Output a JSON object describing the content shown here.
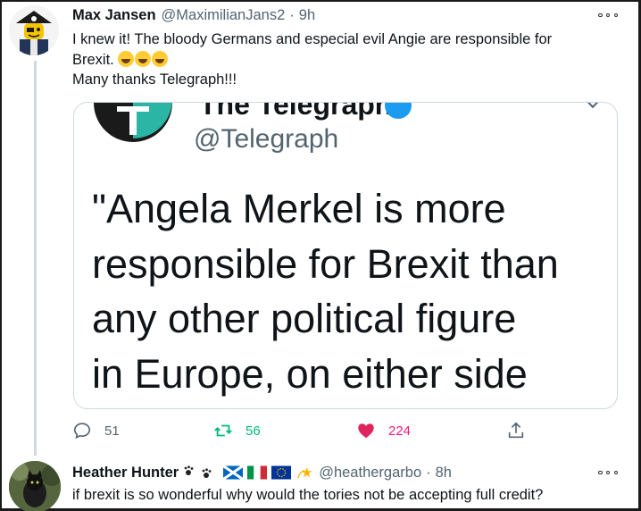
{
  "tweet": {
    "author_name": "Max Jansen",
    "author_handle": "@MaximilianJans2",
    "separator": "·",
    "time": "9h",
    "text_line1": "I knew it! The bloody Germans and especial evil Angie are responsible for",
    "text_line2_prefix": "Brexit.",
    "text_line3": "Many thanks Telegraph!!!",
    "emoji_name": "rolling-on-floor-laughing-icon",
    "emoji_count": 3
  },
  "quoted": {
    "name": "The Telegraph",
    "handle": "@Telegraph",
    "quote_lines": [
      "\"Angela Merkel is more",
      "responsible for Brexit than",
      "any other political figure",
      "in Europe, on either side"
    ]
  },
  "actions": {
    "reply_count": "51",
    "retweet_count": "56",
    "like_count": "224",
    "icons": [
      "reply-icon",
      "retweet-icon",
      "heart-icon",
      "share-icon"
    ]
  },
  "reply": {
    "author_name": "Heather Hunter",
    "author_handle": "@heathergarbo",
    "separator": "·",
    "time": "8h",
    "text": "if brexit is so wonderful why would the tories not be accepting full credit?",
    "name_icons": [
      "paw-prints-icon",
      "scotland-flag-icon",
      "italy-flag-icon",
      "eu-flag-icon",
      "dizzy-star-icon"
    ]
  },
  "colors": {
    "text": "#0f1419",
    "muted": "#536471",
    "border": "#cfd9de",
    "retweet_green": "#00ba7c",
    "like_pink": "#f91880",
    "telegraph_teal": "#2bb5a5"
  }
}
